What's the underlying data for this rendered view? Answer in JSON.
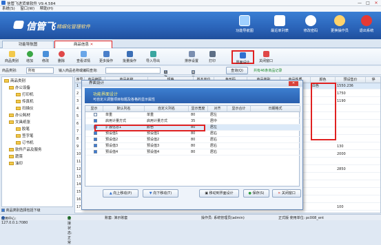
{
  "window": {
    "title": "信管飞进货单软件 V9.4.584",
    "min": "—",
    "max": "□",
    "close": "✕"
  },
  "menu": [
    "系统(S)",
    "窗口(W)",
    "帮助(H)"
  ],
  "banner": {
    "logo_text": "信管飞",
    "slogan": "精细化管理软件",
    "buttons": [
      {
        "label": "功能导航图",
        "icon": "monitor-icon",
        "color": "#9fd0ff"
      },
      {
        "label": "最近单列表",
        "icon": "list-icon",
        "color": "#ffffff"
      },
      {
        "label": "修改密码",
        "icon": "key-icon",
        "color": "#ffffff"
      },
      {
        "label": "更换操作员",
        "icon": "user-switch-icon",
        "color": "#ffd36b"
      },
      {
        "label": "退出系统",
        "icon": "exit-icon",
        "color": "#e53935"
      }
    ]
  },
  "tabs": [
    {
      "label": "功能导航图"
    },
    {
      "label": "商品信息"
    }
  ],
  "toolbar": [
    "商品类别",
    "增加",
    "修改",
    "删除",
    "查看详情",
    "更多操作",
    "批量操作",
    "导入导出",
    "排序设置",
    "打印",
    "界面设计",
    "关闭窗口"
  ],
  "filter": {
    "category_label": "商品类别:",
    "category_value": "所有",
    "search_label": "输入商品名称或编码查询:",
    "exact_label": "精确查询",
    "show_disabled_label": "显示停用商品",
    "query_button": "查询(Q)",
    "summary": "共有46条商品记录"
  },
  "tree": {
    "root": "商品类别",
    "items": [
      "办公设备",
      "打印机",
      "传真机",
      "扫描仪",
      "办公耗材",
      "文具纸张",
      "胶笔",
      "签字笔",
      "订书机",
      "软件产品及服务",
      "蔬菜",
      "油印"
    ],
    "footer": "商品类别选择包括下级"
  },
  "grid": {
    "headers": [
      "序号",
      "商品编码",
      "商品名称",
      "规格",
      "基本单位",
      "条形码",
      "商品类别",
      "商品性质",
      "颜色",
      "预设售价",
      "停"
    ],
    "rows": [
      [
        "1",
        "100101001",
        "EPSON LQ-630k",
        "LQ-630K | 630K",
        "台",
        "6942290000",
        "打印机",
        "库存",
        "白色",
        "1550.236",
        ""
      ],
      [
        "2",
        "1001",
        "",
        "",
        "",
        "",
        "",
        "",
        "",
        "1750",
        ""
      ],
      [
        "3",
        "1001",
        "",
        "",
        "",
        "",
        "",
        "",
        "",
        "1190",
        ""
      ],
      [
        "4",
        "1001",
        "",
        "",
        "",
        "",
        "",
        "",
        "",
        "",
        ""
      ],
      [
        "5",
        "1001",
        "",
        "",
        "",
        "",
        "",
        "",
        "",
        "",
        ""
      ],
      [
        "6",
        "1001",
        "",
        "",
        "",
        "",
        "",
        "",
        "",
        "",
        ""
      ],
      [
        "7",
        "1001",
        "",
        "",
        "",
        "",
        "",
        "",
        "",
        "",
        ""
      ],
      [
        "8",
        "1001",
        "",
        "",
        "",
        "",
        "",
        "",
        "",
        "",
        ""
      ],
      [
        "9",
        "1001",
        "",
        "",
        "",
        "",
        "",
        "",
        "",
        "130",
        ""
      ],
      [
        "10",
        "1001",
        "",
        "",
        "",
        "",
        "",
        "",
        "",
        "2000",
        ""
      ],
      [
        "11",
        "1001",
        "",
        "",
        "",
        "",
        "",
        "",
        "",
        "",
        ""
      ],
      [
        "12",
        "1001",
        "",
        "",
        "",
        "",
        "",
        "",
        "",
        "2850",
        ""
      ],
      [
        "13",
        "1001",
        "",
        "",
        "",
        "",
        "",
        "",
        "",
        "",
        ""
      ],
      [
        "14",
        "1001",
        "",
        "",
        "",
        "",
        "",
        "",
        "",
        "",
        ""
      ],
      [
        "15",
        "1001",
        "",
        "",
        "",
        "",
        "",
        "",
        "",
        "",
        ""
      ],
      [
        "16",
        "1001",
        "",
        "",
        "",
        "",
        "",
        "",
        "",
        "",
        ""
      ],
      [
        "17",
        "1001",
        "",
        "",
        "",
        "",
        "",
        "",
        "",
        "100",
        ""
      ]
    ]
  },
  "color_col_values": [
    "白色",
    "黑色",
    "黑色",
    "",
    "",
    "",
    "",
    "",
    "",
    "",
    ""
  ],
  "dialog": {
    "title": "界面设计",
    "head_title": "功能界面设计",
    "head_sub": "可自定义调整项目标题及各格的显示属性",
    "headers": [
      "显示",
      "默认列名",
      "自定义列名",
      "显示宽度",
      "对齐",
      "显示合计",
      "日期格式"
    ],
    "rows": [
      [
        "",
        "单重",
        "单重",
        "80",
        "居左",
        "",
        ""
      ],
      [
        "",
        "启用计量方式",
        "启用计量方式",
        "35",
        "居中",
        "",
        ""
      ],
      [
        "",
        "扩展信息1",
        "颜色",
        "80",
        "居左",
        "",
        ""
      ],
      [
        "",
        "预设值1",
        "预设值1",
        "80",
        "居右",
        "",
        ""
      ],
      [
        "",
        "预设值2",
        "预设值2",
        "80",
        "居右",
        "",
        ""
      ],
      [
        "",
        "预设值3",
        "预设值3",
        "80",
        "居右",
        "",
        ""
      ],
      [
        "",
        "预设值4",
        "预设值4",
        "80",
        "居右",
        "",
        ""
      ]
    ],
    "buttons": [
      "向上移动(P)",
      "向下移动(T)",
      "移动到界面设计",
      "保存(S)",
      "关闭窗口"
    ]
  },
  "status": {
    "server": "应用中心: 127.0.0.1:7080",
    "state": "连接状态: 正常",
    "company": "账套: 演示账套",
    "operator": "操作员: 系统管理员(admin)",
    "version": "正式版 使用单位: pc008_ent"
  }
}
